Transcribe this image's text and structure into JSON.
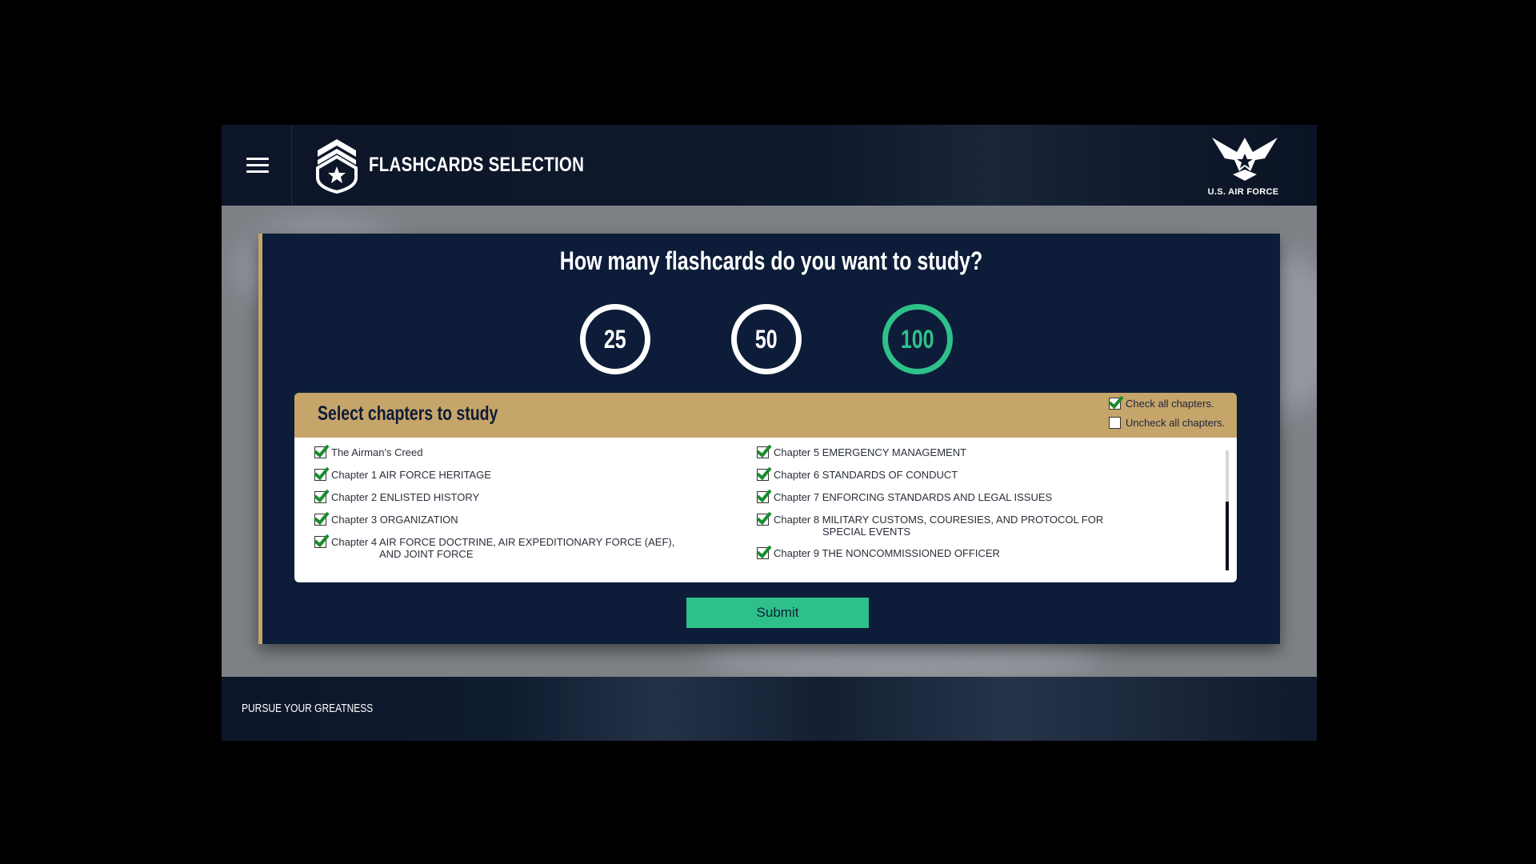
{
  "header": {
    "title": "FLASHCARDS SELECTION",
    "brand": "U.S. AIR FORCE"
  },
  "panel": {
    "question": "How many flashcards do you want to study?",
    "counts": [
      {
        "label": "25",
        "selected": false
      },
      {
        "label": "50",
        "selected": false
      },
      {
        "label": "100",
        "selected": true
      }
    ]
  },
  "chapters": {
    "title": "Select chapters to study",
    "check_all": {
      "label": "Check all chapters.",
      "checked": true
    },
    "uncheck_all": {
      "label": "Uncheck all chapters.",
      "checked": false
    },
    "left": [
      {
        "label": "The Airman's Creed",
        "checked": true
      },
      {
        "label": "Chapter 1 AIR FORCE HERITAGE",
        "checked": true
      },
      {
        "label": "Chapter 2 ENLISTED HISTORY",
        "checked": true
      },
      {
        "label": "Chapter 3 ORGANIZATION",
        "checked": true
      },
      {
        "label": "Chapter 4 AIR FORCE DOCTRINE, AIR EXPEDITIONARY FORCE (AEF),",
        "label2": "AND JOINT FORCE",
        "checked": true
      }
    ],
    "right": [
      {
        "label": "Chapter 5 EMERGENCY MANAGEMENT",
        "checked": true
      },
      {
        "label": "Chapter 6 STANDARDS OF CONDUCT",
        "checked": true
      },
      {
        "label": "Chapter 7 ENFORCING STANDARDS AND LEGAL ISSUES",
        "checked": true
      },
      {
        "label": "Chapter 8 MILITARY CUSTOMS, COURESIES, AND PROTOCOL FOR",
        "label2": "SPECIAL EVENTS",
        "checked": true
      },
      {
        "label": "Chapter 9 THE NONCOMMISSIONED OFFICER",
        "checked": true
      }
    ]
  },
  "submit_label": "Submit",
  "footer": {
    "text": "PURSUE YOUR GREATNESS"
  },
  "colors": {
    "navy": "#0d1c38",
    "gold": "#c6a56a",
    "accent_green": "#2ec08a",
    "check_green": "#1a8c2c"
  }
}
